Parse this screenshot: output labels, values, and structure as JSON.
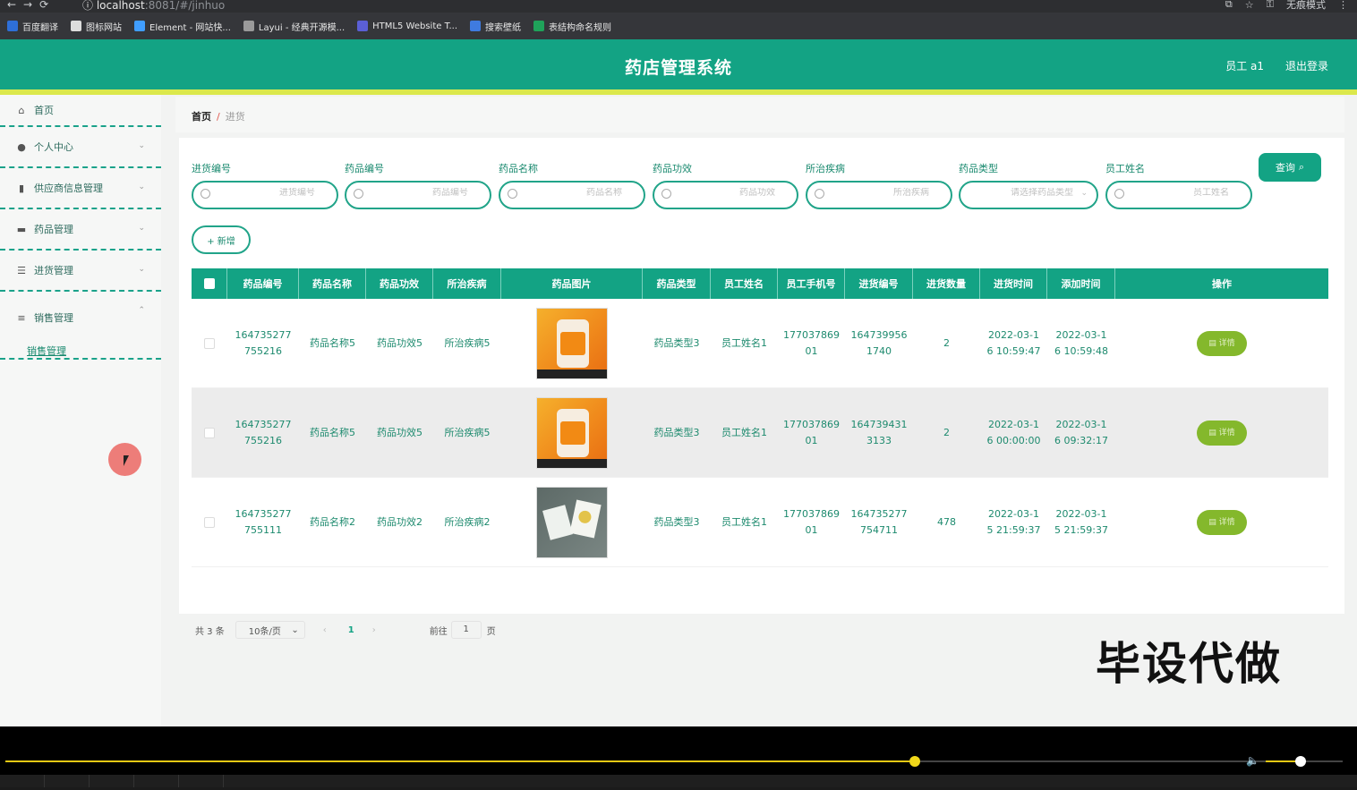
{
  "browser": {
    "url_host": "localhost",
    "url_rest": ":8081/#/jinhuo",
    "profile_label": "无痕模式",
    "bookmarks": [
      "百度翻译",
      "图标网站",
      "Element - 网站快...",
      "Layui - 经典开源模...",
      "HTML5 Website T...",
      "搜索壁纸",
      "表结构命名规则"
    ]
  },
  "header": {
    "title": "药店管理系统",
    "user": "员工 a1",
    "logout": "退出登录"
  },
  "sidebar": {
    "items": [
      {
        "label": "首页"
      },
      {
        "label": "个人中心"
      },
      {
        "label": "供应商信息管理"
      },
      {
        "label": "药品管理"
      },
      {
        "label": "进货管理"
      },
      {
        "label": "销售管理"
      }
    ],
    "submenu": "销售管理"
  },
  "breadcrumb": {
    "home": "首页",
    "sep": "/",
    "current": "进货"
  },
  "filters": {
    "fields": [
      {
        "label": "进货编号",
        "placeholder": "进货编号"
      },
      {
        "label": "药品编号",
        "placeholder": "药品编号"
      },
      {
        "label": "药品名称",
        "placeholder": "药品名称"
      },
      {
        "label": "药品功效",
        "placeholder": "药品功效"
      },
      {
        "label": "所治疾病",
        "placeholder": "所治疾病"
      },
      {
        "label": "药品类型",
        "placeholder": "请选择药品类型"
      },
      {
        "label": "员工姓名",
        "placeholder": "员工姓名"
      }
    ],
    "query_button": "查询",
    "add_button": "+ 新增"
  },
  "table": {
    "columns": [
      "药品编号",
      "药品名称",
      "药品功效",
      "所治疾病",
      "药品图片",
      "药品类型",
      "员工姓名",
      "员工手机号",
      "进货编号",
      "进货数量",
      "进货时间",
      "添加时间",
      "操作"
    ],
    "rows": [
      {
        "drug_no_1": "164735277",
        "drug_no_2": "755216",
        "name": "药品名称5",
        "effect": "药品功效5",
        "disease": "所治疾病5",
        "image": "orange",
        "type": "药品类型3",
        "staff": "员工姓名1",
        "phone_1": "177037869",
        "phone_2": "01",
        "purchase_no_1": "164739956",
        "purchase_no_2": "1740",
        "qty": "2",
        "time_1": "2022-03-1",
        "time_2": "6 10:59:47",
        "added_1": "2022-03-1",
        "added_2": "6 10:59:48",
        "action": "详情"
      },
      {
        "drug_no_1": "164735277",
        "drug_no_2": "755216",
        "name": "药品名称5",
        "effect": "药品功效5",
        "disease": "所治疾病5",
        "image": "orange",
        "type": "药品类型3",
        "staff": "员工姓名1",
        "phone_1": "177037869",
        "phone_2": "01",
        "purchase_no_1": "164739431",
        "purchase_no_2": "3133",
        "qty": "2",
        "time_1": "2022-03-1",
        "time_2": "6 00:00:00",
        "added_1": "2022-03-1",
        "added_2": "6 09:32:17",
        "action": "详情"
      },
      {
        "drug_no_1": "164735277",
        "drug_no_2": "755111",
        "name": "药品名称2",
        "effect": "药品功效2",
        "disease": "所治疾病2",
        "image": "gray",
        "type": "药品类型3",
        "staff": "员工姓名1",
        "phone_1": "177037869",
        "phone_2": "01",
        "purchase_no_1": "164735277",
        "purchase_no_2": "754711",
        "qty": "478",
        "time_1": "2022-03-1",
        "time_2": "5 21:59:37",
        "added_1": "2022-03-1",
        "added_2": "5 21:59:37",
        "action": "详情"
      }
    ]
  },
  "pagination": {
    "total": "共 3 条",
    "page_size": "10条/页",
    "current": "1",
    "goto_label": "前往",
    "goto_value": "1",
    "page_label": "页"
  },
  "watermark": "毕设代做",
  "player": {
    "seek_progress": 0.68,
    "volume": 0.45
  },
  "colors": {
    "primary": "#13a384",
    "accent_bar": "#dbe84c",
    "detail_button": "#84b82c"
  }
}
